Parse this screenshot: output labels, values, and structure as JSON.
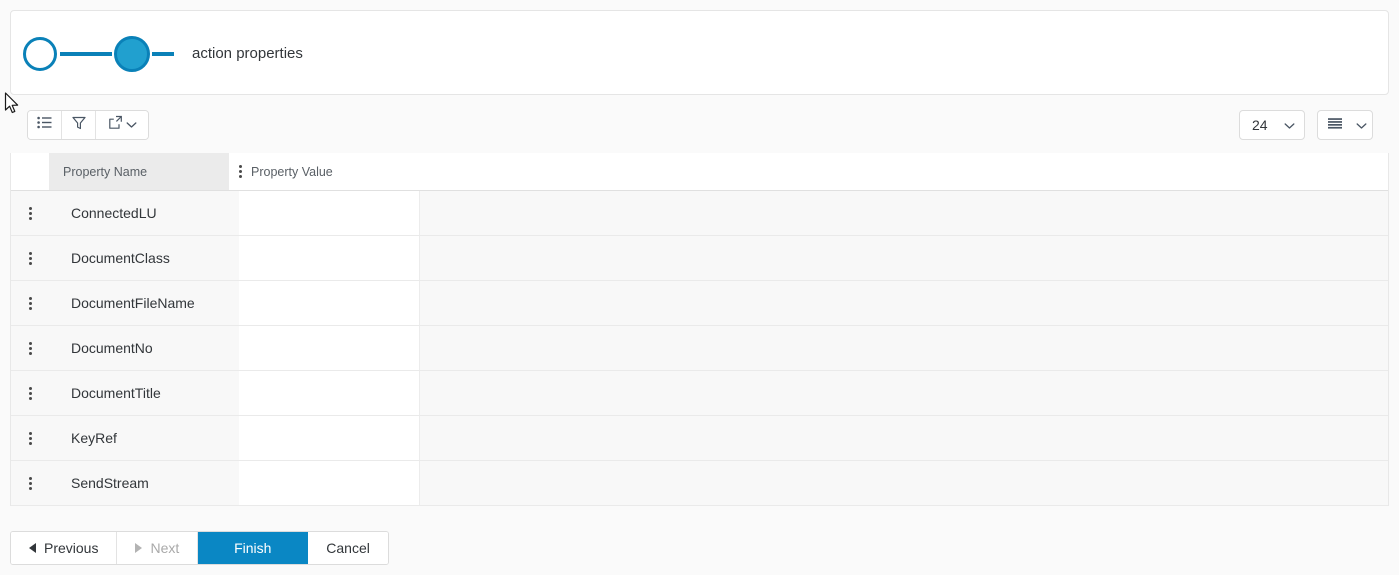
{
  "wizard": {
    "steps": [
      {
        "id": "step-1",
        "state": "pending",
        "label": ""
      },
      {
        "id": "step-2",
        "state": "active",
        "label": "action properties"
      }
    ],
    "current_label": "action properties"
  },
  "toolbar": {
    "buttons": [
      {
        "name": "list-view-button",
        "icon": "bulleted-list-icon",
        "label": ""
      },
      {
        "name": "filter-button",
        "icon": "filter-funnel-icon",
        "label": ""
      },
      {
        "name": "export-button",
        "icon": "export-icon",
        "label": ""
      }
    ],
    "page_size": {
      "value": "24",
      "icon": "chevron-down-icon"
    },
    "density": {
      "value": "",
      "icon": "rows-density-icon",
      "chevron": "chevron-down-icon"
    }
  },
  "table": {
    "columns": [
      {
        "key": "property_name",
        "label": "Property Name"
      },
      {
        "key": "property_value",
        "label": "Property Value"
      }
    ],
    "rows": [
      {
        "property_name": "ConnectedLU",
        "property_value": ""
      },
      {
        "property_name": "DocumentClass",
        "property_value": ""
      },
      {
        "property_name": "DocumentFileName",
        "property_value": ""
      },
      {
        "property_name": "DocumentNo",
        "property_value": ""
      },
      {
        "property_name": "DocumentTitle",
        "property_value": ""
      },
      {
        "property_name": "KeyRef",
        "property_value": ""
      },
      {
        "property_name": "SendStream",
        "property_value": ""
      }
    ]
  },
  "footer": {
    "previous": "Previous",
    "next": "Next",
    "finish": "Finish",
    "cancel": "Cancel"
  },
  "colors": {
    "accent_blue": "#0a87c4",
    "step_blue": "#21a0cf",
    "step_border": "#0a81b8",
    "text": "#32363a",
    "muted": "#5a6066",
    "disabled": "#a9a9a9",
    "row_bg": "#f8f8f8",
    "header_cell_bg": "#ebebeb"
  }
}
